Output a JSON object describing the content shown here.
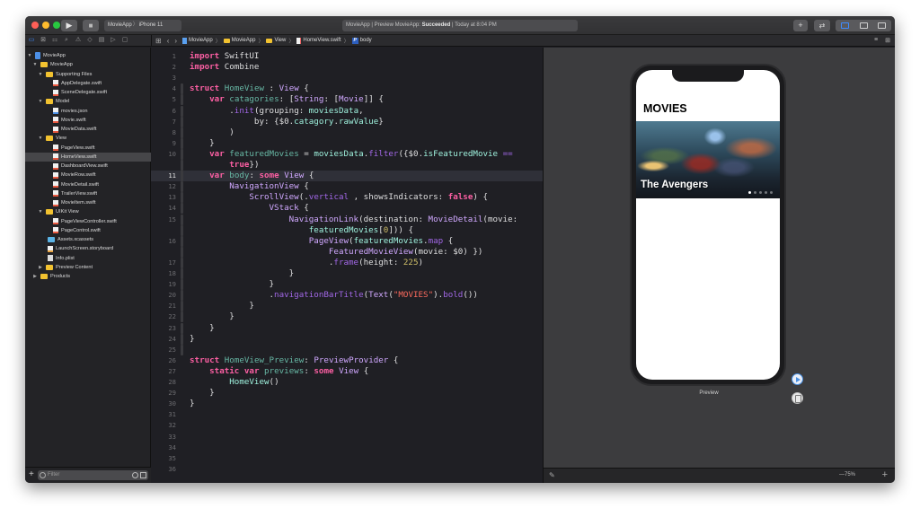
{
  "titlebar": {
    "run_icon": "▶",
    "stop_icon": "■",
    "scheme": "MovieApp",
    "destination": "iPhone 11",
    "status_prefix": "MovieApp | Preview MovieApp: ",
    "status_bold": "Succeeded",
    "status_suffix": " | Today at 8:04 PM",
    "add_icon": "+",
    "swap_icon": "⇄"
  },
  "jumpbar": {
    "grid_icon": "⊞",
    "back_icon": "‹",
    "forward_icon": "›",
    "crumbs": [
      "MovieApp",
      "MovieApp",
      "View",
      "HomeView.swift",
      "body"
    ],
    "badge": "P",
    "right_icons": [
      "≡",
      "⊞"
    ]
  },
  "navigator": {
    "tabs": [
      "▭",
      "⊠",
      "⚏",
      "⌕",
      "⚠",
      "◇",
      "▤",
      "▷",
      "▢"
    ],
    "items": [
      {
        "label": "MovieApp",
        "type": "proj",
        "disc": "▼"
      },
      {
        "label": "MovieApp",
        "type": "folder",
        "disc": "▼"
      },
      {
        "label": "Supporting Files",
        "type": "folder",
        "disc": "▼"
      },
      {
        "label": "AppDelegate.swift",
        "type": "swift",
        "disc": ""
      },
      {
        "label": "SceneDelegate.swift",
        "type": "swift",
        "disc": ""
      },
      {
        "label": "Model",
        "type": "folder",
        "disc": "▼"
      },
      {
        "label": "movies.json",
        "type": "json",
        "disc": ""
      },
      {
        "label": "Movie.swift",
        "type": "swift",
        "disc": ""
      },
      {
        "label": "MovieData.swift",
        "type": "swift",
        "disc": ""
      },
      {
        "label": "View",
        "type": "folder",
        "disc": "▼"
      },
      {
        "label": "PageView.swift",
        "type": "swift",
        "disc": ""
      },
      {
        "label": "HomeView.swift",
        "type": "swift",
        "disc": "",
        "selected": true
      },
      {
        "label": "DashboardView.swift",
        "type": "swift",
        "disc": ""
      },
      {
        "label": "MovieRow.swift",
        "type": "swift",
        "disc": ""
      },
      {
        "label": "MovieDetail.swift",
        "type": "swift",
        "disc": ""
      },
      {
        "label": "TrailerView.swift",
        "type": "swift",
        "disc": ""
      },
      {
        "label": "MovieItem.swift",
        "type": "swift",
        "disc": ""
      },
      {
        "label": "UIKit View",
        "type": "folder",
        "disc": "▼"
      },
      {
        "label": "PageViewController.swift",
        "type": "swift",
        "disc": ""
      },
      {
        "label": "PageControl.swift",
        "type": "swift",
        "disc": ""
      },
      {
        "label": "Assets.xcassets",
        "type": "assets",
        "disc": ""
      },
      {
        "label": "LaunchScreen.storyboard",
        "type": "sb",
        "disc": ""
      },
      {
        "label": "Info.plist",
        "type": "plist",
        "disc": ""
      },
      {
        "label": "Preview Content",
        "type": "folder",
        "disc": "▶"
      },
      {
        "label": "Products",
        "type": "folder",
        "disc": "▶"
      }
    ],
    "filter_add": "+",
    "filter_placeholder": "Filter"
  },
  "editor": {
    "current_line": 11,
    "lines": [
      {
        "n": "1",
        "t": [
          [
            "kw",
            "import"
          ],
          [
            "pl",
            " SwiftUI"
          ]
        ]
      },
      {
        "n": "2",
        "t": [
          [
            "kw",
            "import"
          ],
          [
            "pl",
            " Combine"
          ]
        ]
      },
      {
        "n": "3",
        "t": []
      },
      {
        "n": "4",
        "t": [
          [
            "kw",
            "struct"
          ],
          [
            "pl",
            " "
          ],
          [
            "id",
            "HomeView"
          ],
          [
            "pl",
            " : "
          ],
          [
            "ty",
            "View"
          ],
          [
            "pl",
            " {"
          ]
        ]
      },
      {
        "n": "5",
        "t": [
          [
            "pl",
            "    "
          ],
          [
            "kw",
            "var"
          ],
          [
            "pl",
            " "
          ],
          [
            "id",
            "catagories"
          ],
          [
            "pl",
            ": ["
          ],
          [
            "ty",
            "String"
          ],
          [
            "pl",
            ": ["
          ],
          [
            "ty",
            "Movie"
          ],
          [
            "pl",
            "]] {"
          ]
        ]
      },
      {
        "n": "6",
        "t": [
          [
            "pl",
            "        ."
          ],
          [
            "fn",
            "init"
          ],
          [
            "pl",
            "(grouping: "
          ],
          [
            "ut",
            "moviesData"
          ],
          [
            "pl",
            ","
          ]
        ]
      },
      {
        "n": "7",
        "t": [
          [
            "pl",
            "             by: {$0."
          ],
          [
            "ut",
            "catagory"
          ],
          [
            "pl",
            "."
          ],
          [
            "ut",
            "rawValue"
          ],
          [
            "pl",
            "}"
          ]
        ]
      },
      {
        "n": "8",
        "t": [
          [
            "pl",
            "        )"
          ]
        ]
      },
      {
        "n": "9",
        "t": [
          [
            "pl",
            "    }"
          ]
        ]
      },
      {
        "n": "10",
        "t": [
          [
            "pl",
            "    "
          ],
          [
            "kw",
            "var"
          ],
          [
            "pl",
            " "
          ],
          [
            "id",
            "featuredMovies"
          ],
          [
            "pl",
            " = "
          ],
          [
            "ut",
            "moviesData"
          ],
          [
            "pl",
            "."
          ],
          [
            "fn",
            "filter"
          ],
          [
            "pl",
            "({$0."
          ],
          [
            "ut",
            "isFeaturedMovie"
          ],
          [
            "pl",
            " "
          ],
          [
            "fn",
            "=="
          ]
        ]
      },
      {
        "n": "",
        "t": [
          [
            "pl",
            "        "
          ],
          [
            "kw",
            "true"
          ],
          [
            "pl",
            "})"
          ]
        ]
      },
      {
        "n": "11",
        "t": [
          [
            "pl",
            "    "
          ],
          [
            "kw",
            "var"
          ],
          [
            "pl",
            " "
          ],
          [
            "id",
            "body"
          ],
          [
            "pl",
            ": "
          ],
          [
            "kw",
            "some"
          ],
          [
            "pl",
            " "
          ],
          [
            "ty",
            "View"
          ],
          [
            "pl",
            " {"
          ]
        ]
      },
      {
        "n": "12",
        "t": [
          [
            "pl",
            "        "
          ],
          [
            "ty",
            "NavigationView"
          ],
          [
            "pl",
            " {"
          ]
        ]
      },
      {
        "n": "13",
        "t": [
          [
            "pl",
            "            "
          ],
          [
            "ty",
            "ScrollView"
          ],
          [
            "pl",
            "(."
          ],
          [
            "fn",
            "vertical"
          ],
          [
            "pl",
            " , showsIndicators: "
          ],
          [
            "kw",
            "false"
          ],
          [
            "pl",
            ") {"
          ]
        ]
      },
      {
        "n": "14",
        "t": [
          [
            "pl",
            "                "
          ],
          [
            "ty",
            "VStack"
          ],
          [
            "pl",
            " {"
          ]
        ]
      },
      {
        "n": "15",
        "t": [
          [
            "pl",
            "                    "
          ],
          [
            "ty",
            "NavigationLink"
          ],
          [
            "pl",
            "(destination: "
          ],
          [
            "ty",
            "MovieDetail"
          ],
          [
            "pl",
            "(movie:"
          ]
        ]
      },
      {
        "n": "",
        "t": [
          [
            "pl",
            "                        "
          ],
          [
            "ut",
            "featuredMovies"
          ],
          [
            "pl",
            "["
          ],
          [
            "nu",
            "0"
          ],
          [
            "pl",
            "])) {"
          ]
        ]
      },
      {
        "n": "16",
        "t": [
          [
            "pl",
            "                        "
          ],
          [
            "ty",
            "PageView"
          ],
          [
            "pl",
            "("
          ],
          [
            "ut",
            "featuredMovies"
          ],
          [
            "pl",
            "."
          ],
          [
            "fn",
            "map"
          ],
          [
            "pl",
            " {"
          ]
        ]
      },
      {
        "n": "",
        "t": [
          [
            "pl",
            "                            "
          ],
          [
            "ty",
            "FeaturedMovieView"
          ],
          [
            "pl",
            "(movie: $0) })"
          ]
        ]
      },
      {
        "n": "17",
        "t": [
          [
            "pl",
            "                            ."
          ],
          [
            "fn",
            "frame"
          ],
          [
            "pl",
            "(height: "
          ],
          [
            "nu",
            "225"
          ],
          [
            "pl",
            ")"
          ]
        ]
      },
      {
        "n": "18",
        "t": [
          [
            "pl",
            "                    }"
          ]
        ]
      },
      {
        "n": "19",
        "t": [
          [
            "pl",
            "                }"
          ]
        ]
      },
      {
        "n": "20",
        "t": [
          [
            "pl",
            "                ."
          ],
          [
            "fn",
            "navigationBarTitle"
          ],
          [
            "pl",
            "("
          ],
          [
            "ty",
            "Text"
          ],
          [
            "pl",
            "("
          ],
          [
            "st",
            "\"MOVIES\""
          ],
          [
            "pl",
            ")."
          ],
          [
            "fn",
            "bold"
          ],
          [
            "pl",
            "())"
          ]
        ]
      },
      {
        "n": "21",
        "t": [
          [
            "pl",
            "            }"
          ]
        ]
      },
      {
        "n": "22",
        "t": [
          [
            "pl",
            "        }"
          ]
        ]
      },
      {
        "n": "23",
        "t": [
          [
            "pl",
            "    }"
          ]
        ]
      },
      {
        "n": "24",
        "t": [
          [
            "pl",
            "}"
          ]
        ]
      },
      {
        "n": "25",
        "t": []
      },
      {
        "n": "26",
        "t": [
          [
            "kw",
            "struct"
          ],
          [
            "pl",
            " "
          ],
          [
            "id",
            "HomeView_Preview"
          ],
          [
            "pl",
            ": "
          ],
          [
            "ty",
            "PreviewProvider"
          ],
          [
            "pl",
            " {"
          ]
        ]
      },
      {
        "n": "27",
        "t": [
          [
            "pl",
            "    "
          ],
          [
            "kw",
            "static"
          ],
          [
            "pl",
            " "
          ],
          [
            "kw",
            "var"
          ],
          [
            "pl",
            " "
          ],
          [
            "id",
            "previews"
          ],
          [
            "pl",
            ": "
          ],
          [
            "kw",
            "some"
          ],
          [
            "pl",
            " "
          ],
          [
            "ty",
            "View"
          ],
          [
            "pl",
            " {"
          ]
        ]
      },
      {
        "n": "28",
        "t": [
          [
            "pl",
            "        "
          ],
          [
            "ut",
            "HomeView"
          ],
          [
            "pl",
            "()"
          ]
        ]
      },
      {
        "n": "29",
        "t": [
          [
            "pl",
            "    }"
          ]
        ]
      },
      {
        "n": "30",
        "t": [
          [
            "pl",
            "}"
          ]
        ]
      },
      {
        "n": "31",
        "t": []
      },
      {
        "n": "32",
        "t": []
      },
      {
        "n": "33",
        "t": []
      },
      {
        "n": "34",
        "t": []
      },
      {
        "n": "35",
        "t": []
      },
      {
        "n": "36",
        "t": []
      }
    ]
  },
  "preview": {
    "nav_title": "MOVIES",
    "featured_title": "The Avengers",
    "page_count": 5,
    "current_page": 1,
    "label": "Preview",
    "pin_icon": "✎",
    "zoom_level": "—75%",
    "zoom_plus": "+"
  }
}
